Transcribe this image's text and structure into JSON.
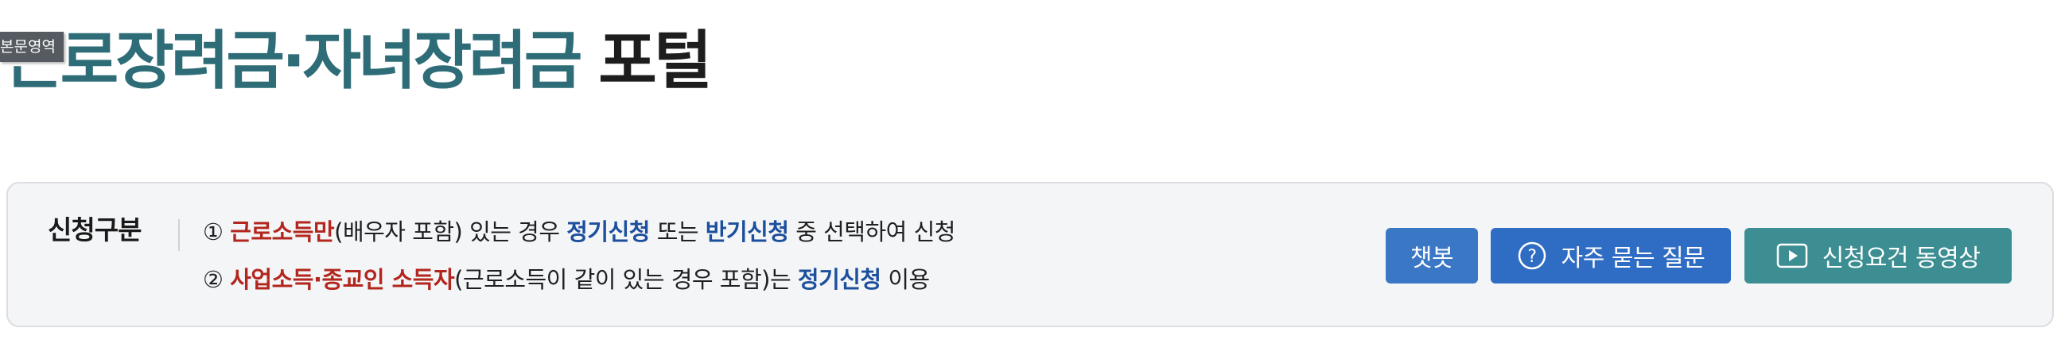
{
  "skip_link": {
    "label": "본문영역"
  },
  "header": {
    "title_accent": "근로장려금·자녀장려금",
    "title_plain": " 포털"
  },
  "application_type": {
    "label": "신청구분",
    "line1": {
      "num": "① ",
      "red": "근로소득만",
      "text_a": "(배우자 포함) 있는 경우 ",
      "blue1": "정기신청",
      "text_b": " 또는 ",
      "blue2": "반기신청",
      "text_c": " 중 선택하여 신청"
    },
    "line2": {
      "num": "② ",
      "red": "사업소득·종교인 소득자",
      "text_a": "(근로소득이 같이 있는 경우 포함)는 ",
      "blue": "정기신청",
      "text_b": " 이용"
    }
  },
  "buttons": {
    "chatbot": "챗봇",
    "faq": "자주 묻는 질문",
    "video": "신청요건 동영상"
  },
  "colors": {
    "title_accent": "#2e6d78",
    "emphasis_red": "#b3261e",
    "emphasis_blue": "#1c4f9c",
    "chatbot_button": "#3a77c4",
    "faq_button": "#2f6cc3",
    "video_button": "#3c8e93"
  },
  "icons": {
    "faq": "question-circle-icon",
    "video": "play-video-icon"
  }
}
